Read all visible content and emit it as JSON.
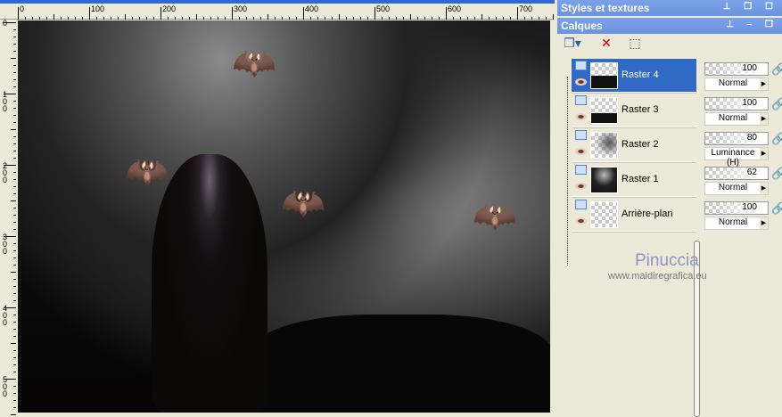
{
  "rulers": {
    "horizontal": [
      "0",
      "100",
      "200",
      "300",
      "400",
      "500",
      "600",
      "700"
    ],
    "vertical": [
      "0",
      "100",
      "200",
      "300",
      "400",
      "500"
    ]
  },
  "panels": {
    "styles_title": "Styles et textures",
    "layers_title": "Calques"
  },
  "toolbar": {
    "new_layer": "new-layer-icon",
    "delete_layer": "delete-layer-icon",
    "edit_selection": "edit-selection-icon"
  },
  "layers": [
    {
      "name": "Raster 4",
      "opacity": "100",
      "blend": "Normal",
      "selected": true
    },
    {
      "name": "Raster 3",
      "opacity": "100",
      "blend": "Normal",
      "selected": false
    },
    {
      "name": "Raster 2",
      "opacity": "80",
      "blend": "Luminance (H)",
      "selected": false
    },
    {
      "name": "Raster 1",
      "opacity": "62",
      "blend": "Normal",
      "selected": false
    },
    {
      "name": "Arrière-plan",
      "opacity": "100",
      "blend": "Normal",
      "selected": false
    }
  ],
  "watermark": {
    "name": "Pinuccia",
    "url": "www.maidiregrafica.eu"
  },
  "colors": {
    "titlebar": "#6b94de",
    "selection": "#316ac5",
    "panel": "#ece9d8"
  }
}
